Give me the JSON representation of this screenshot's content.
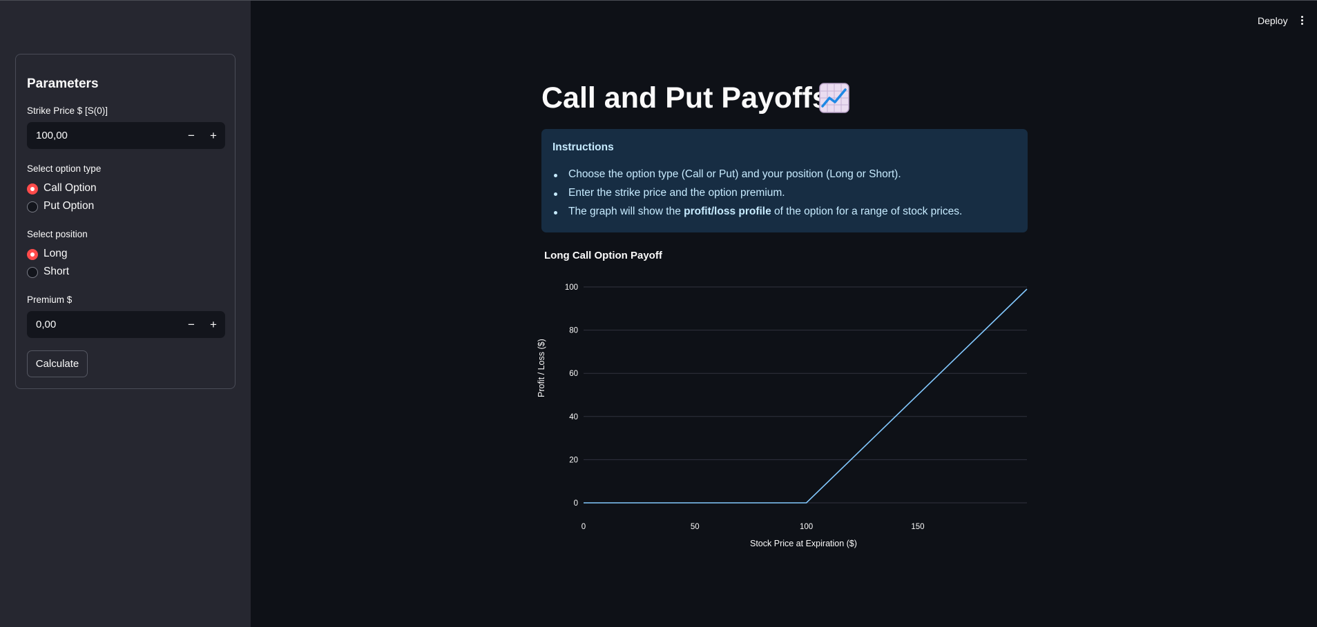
{
  "header": {
    "deploy_label": "Deploy",
    "menu_icon": "more-vert-icon"
  },
  "sidebar": {
    "title": "Parameters",
    "strike": {
      "label": "Strike Price $ [S(0)]",
      "value": "100,00",
      "minus": "−",
      "plus": "+"
    },
    "option_type": {
      "label": "Select option type",
      "options": [
        "Call Option",
        "Put Option"
      ],
      "selected": "Call Option"
    },
    "position": {
      "label": "Select position",
      "options": [
        "Long",
        "Short"
      ],
      "selected": "Long"
    },
    "premium": {
      "label": "Premium $",
      "value": "0,00",
      "minus": "−",
      "plus": "+"
    },
    "calculate_label": "Calculate"
  },
  "main": {
    "title": "Call and Put Payoffs",
    "title_icon": "chart-increasing-icon",
    "instructions": {
      "title": "Instructions",
      "item1": "Choose the option type (Call or Put) and your position (Long or Short).",
      "item2": "Enter the strike price and the option premium.",
      "item3_pre": "The graph will show the ",
      "item3_bold": "profit/loss profile",
      "item3_post": " of the option for a range of stock prices."
    }
  },
  "colors": {
    "accent_radio": "#ff4b4b",
    "line": "#83c9ff",
    "info_bg": "#172d43",
    "info_text": "#c7ebff"
  },
  "chart_data": {
    "type": "line",
    "title": "Long Call Option Payoff",
    "xlabel": "Stock Price at Expiration ($)",
    "ylabel": "Profit / Loss ($)",
    "xlim": [
      0,
      199
    ],
    "ylim": [
      0,
      100
    ],
    "x_ticks": [
      0,
      50,
      100,
      150
    ],
    "y_ticks": [
      0,
      20,
      40,
      60,
      80,
      100
    ],
    "grid": "horizontal",
    "series": [
      {
        "x": [
          0,
          100,
          199
        ],
        "y": [
          0,
          0,
          99
        ]
      }
    ]
  }
}
